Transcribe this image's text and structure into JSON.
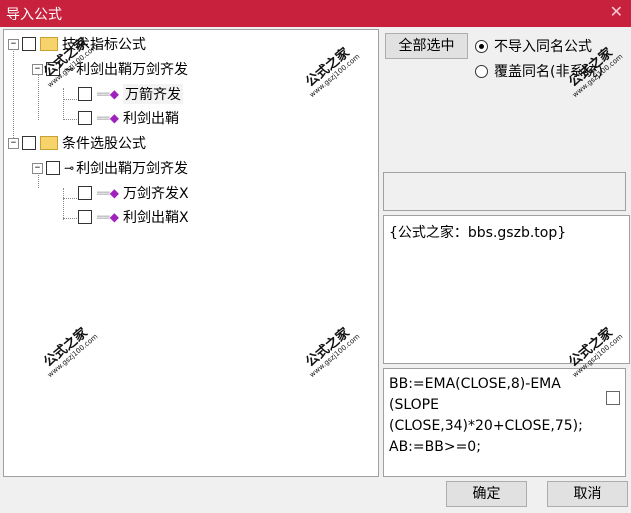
{
  "window": {
    "title": "导入公式",
    "close_glyph": "✕"
  },
  "tree": {
    "items": [
      {
        "label": "技术指标公式",
        "expander": "−"
      },
      {
        "label": "利剑出鞘万剑齐发",
        "expander": "−"
      },
      {
        "label": "万箭齐发"
      },
      {
        "label": "利剑出鞘"
      },
      {
        "label": "条件选股公式",
        "expander": "−"
      },
      {
        "label": "利剑出鞘万剑齐发",
        "expander": "−"
      },
      {
        "label": "万剑齐发X"
      },
      {
        "label": "利剑出鞘X"
      }
    ]
  },
  "options": {
    "select_all_label": "全部选中",
    "radio_no_import": "不导入同名公式",
    "radio_overwrite": "覆盖同名(非系统)"
  },
  "description": "{公式之家：bbs.gszb.top}",
  "formula": "BB:=EMA(CLOSE,8)-EMA\n(SLOPE\n(CLOSE,34)*20+CLOSE,75);\nAB:=BB>=0;",
  "buttons": {
    "ok": "确定",
    "cancel": "取消"
  },
  "watermark": {
    "text": "公式之家",
    "url": "www.gszj100.com"
  }
}
